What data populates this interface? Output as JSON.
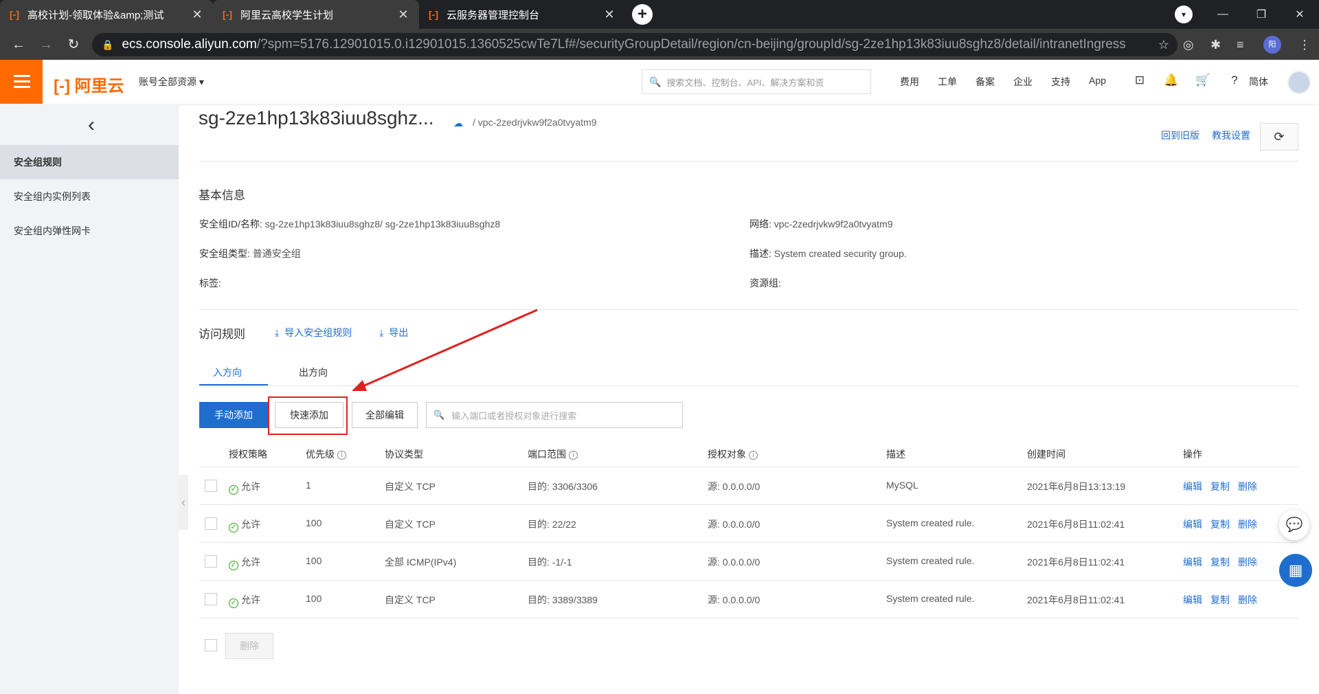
{
  "browser": {
    "tabs": [
      {
        "favicon": "[-]",
        "title": "高校计划-领取体验&amp;测试"
      },
      {
        "favicon": "[-]",
        "title": "阿里云高校学生计划"
      },
      {
        "favicon": "[-]",
        "title": "云服务器管理控制台"
      }
    ],
    "url_host": "ecs.console.aliyun.com",
    "url_path": "/?spm=5176.12901015.0.i12901015.1360525cwTe7Lf#/securityGroupDetail/region/cn-beijing/groupId/sg-2ze1hp13k83iuu8sghz8/detail/intranetIngress",
    "profile_initial": "阳"
  },
  "topbar": {
    "logo": "[-] 阿里云",
    "account_label": "账号全部资源",
    "search_placeholder": "搜索文档、控制台、API、解决方案和资",
    "nav": [
      "费用",
      "工单",
      "备案",
      "企业",
      "支持",
      "App"
    ],
    "lang": "简体"
  },
  "sidebar": {
    "items": [
      "安全组规则",
      "安全组内实例列表",
      "安全组内弹性网卡"
    ]
  },
  "header": {
    "title": "sg-2ze1hp13k83iuu8sghz...",
    "vpc_crumb": "/ vpc-2zedrjvkw9f2a0tvyatm9",
    "link_old": "回到旧版",
    "link_settings": "教我设置"
  },
  "basic": {
    "title": "基本信息",
    "id_label": "安全组ID/名称:",
    "id_value": "sg-2ze1hp13k83iuu8sghz8/ sg-2ze1hp13k83iuu8sghz8",
    "type_label": "安全组类型:",
    "type_value": "普通安全组",
    "tag_label": "标签:",
    "net_label": "网络:",
    "net_value": "vpc-2zedrjvkw9f2a0tvyatm9",
    "desc_label": "描述:",
    "desc_value": "System created security group.",
    "rg_label": "资源组:"
  },
  "rules": {
    "title": "访问规则",
    "import": "导入安全组规则",
    "export": "导出",
    "tab_in": "入方向",
    "tab_out": "出方向",
    "btn_manual": "手动添加",
    "btn_quick": "快速添加",
    "btn_edit_all": "全部编辑",
    "filter_placeholder": "输入端口或者授权对象进行搜索",
    "columns": [
      "授权策略",
      "优先级",
      "协议类型",
      "端口范围",
      "授权对象",
      "描述",
      "创建时间",
      "操作"
    ],
    "rows": [
      {
        "policy": "允许",
        "priority": "1",
        "protocol": "自定义 TCP",
        "port": "目的: 3306/3306",
        "source": "源: 0.0.0.0/0",
        "desc": "MySQL",
        "time": "2021年6月8日13:13:19"
      },
      {
        "policy": "允许",
        "priority": "100",
        "protocol": "自定义 TCP",
        "port": "目的: 22/22",
        "source": "源: 0.0.0.0/0",
        "desc": "System created rule.",
        "time": "2021年6月8日11:02:41"
      },
      {
        "policy": "允许",
        "priority": "100",
        "protocol": "全部 ICMP(IPv4)",
        "port": "目的: -1/-1",
        "source": "源: 0.0.0.0/0",
        "desc": "System created rule.",
        "time": "2021年6月8日11:02:41"
      },
      {
        "policy": "允许",
        "priority": "100",
        "protocol": "自定义 TCP",
        "port": "目的: 3389/3389",
        "source": "源: 0.0.0.0/0",
        "desc": "System created rule.",
        "time": "2021年6月8日11:02:41"
      }
    ],
    "actions": [
      "编辑",
      "复制",
      "删除"
    ],
    "btn_delete": "删除"
  },
  "colors": {
    "brand_orange": "#ff6a00",
    "primary_blue": "#1f6ecd",
    "highlight_red": "#e02020",
    "allow_green": "#2aa515"
  }
}
